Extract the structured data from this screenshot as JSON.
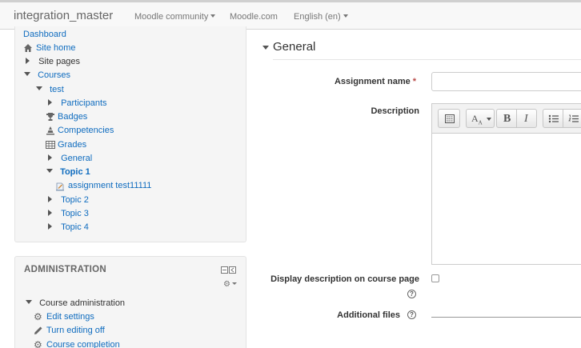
{
  "navbar": {
    "brand": "integration_master",
    "items": [
      "Moodle community",
      "Moodle.com",
      "English (en)"
    ]
  },
  "navigation": {
    "dashboard": "Dashboard",
    "site_home": "Site home",
    "site_pages": "Site pages",
    "courses": "Courses",
    "course": "test",
    "participants": "Participants",
    "badges": "Badges",
    "competencies": "Competencies",
    "grades": "Grades",
    "general": "General",
    "topic1": "Topic 1",
    "assignment": "assignment test11111",
    "topic2": "Topic 2",
    "topic3": "Topic 3",
    "topic4": "Topic 4"
  },
  "administration": {
    "title": "ADMINISTRATION",
    "course_admin": "Course administration",
    "edit_settings": "Edit settings",
    "turn_editing_off": "Turn editing off",
    "course_completion": "Course completion"
  },
  "form": {
    "section": "General",
    "assignment_name_label": "Assignment name",
    "assignment_name_value": "",
    "description_label": "Description",
    "display_description_label": "Display description on course page",
    "display_description_checked": false,
    "additional_files_label": "Additional files"
  },
  "colors": {
    "link": "#0f6cbf",
    "required": "#b94a48"
  }
}
